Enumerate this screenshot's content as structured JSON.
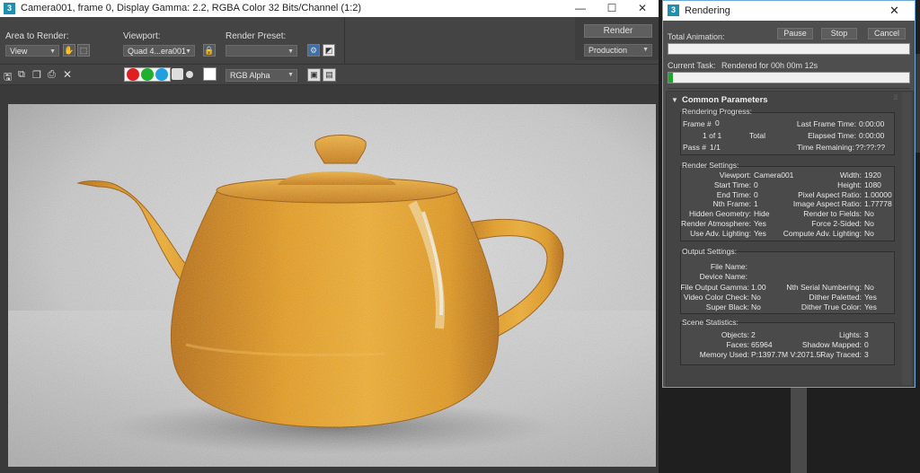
{
  "frame_window": {
    "title": "Camera001, frame 0, Display Gamma: 2.2, RGBA Color 32 Bits/Channel (1:2)",
    "icon_letter": "3",
    "minimize": "—",
    "maximize": "☐",
    "close": "✕",
    "area_to_render_label": "Area to Render:",
    "area_to_render_value": "View",
    "viewport_label": "Viewport:",
    "viewport_value": "Quad 4...era001",
    "render_preset_label": "Render Preset:",
    "render_preset_value": "",
    "render_button": "Render",
    "production_value": "Production",
    "channel_display_value": "RGB Alpha",
    "channel_colors": {
      "red": "#e02020",
      "green": "#20b030",
      "blue": "#20a0e0"
    }
  },
  "rendering_dialog": {
    "icon_letter": "3",
    "title": "Rendering",
    "close": "✕",
    "total_animation_label": "Total Animation:",
    "pause_button": "Pause",
    "stop_button": "Stop",
    "cancel_button": "Cancel",
    "current_task_label": "Current Task:",
    "current_task_value": "Rendered for 00h 00m 12s",
    "current_task_progress": 0.02,
    "common_parameters_label": "Common Parameters",
    "rendering_progress": {
      "label": "Rendering Progress:",
      "frame_label": "Frame #",
      "frame_value": "0",
      "of_value": "1 of 1",
      "total_label": "Total",
      "pass_label": "Pass #",
      "pass_value": "1/1",
      "last_frame_time_label": "Last Frame Time:",
      "last_frame_time_value": "0:00:00",
      "elapsed_time_label": "Elapsed Time:",
      "elapsed_time_value": "0:00:00",
      "time_remaining_label": "Time Remaining:",
      "time_remaining_value": "??:??:??"
    },
    "render_settings": {
      "label": "Render Settings:",
      "left": [
        {
          "label": "Viewport:",
          "value": "Camera001"
        },
        {
          "label": "Start Time:",
          "value": "0"
        },
        {
          "label": "End Time:",
          "value": "0"
        },
        {
          "label": "Nth Frame:",
          "value": "1"
        },
        {
          "label": "Hidden Geometry:",
          "value": "Hide"
        },
        {
          "label": "Render Atmosphere:",
          "value": "Yes"
        },
        {
          "label": "Use Adv. Lighting:",
          "value": "Yes"
        }
      ],
      "right": [
        {
          "label": "Width:",
          "value": "1920"
        },
        {
          "label": "Height:",
          "value": "1080"
        },
        {
          "label": "Pixel Aspect Ratio:",
          "value": "1.00000"
        },
        {
          "label": "Image Aspect Ratio:",
          "value": "1.77778"
        },
        {
          "label": "Render to Fields:",
          "value": "No"
        },
        {
          "label": "Force 2-Sided:",
          "value": "No"
        },
        {
          "label": "Compute Adv. Lighting:",
          "value": "No"
        }
      ]
    },
    "output_settings": {
      "label": "Output Settings:",
      "file_name_label": "File Name:",
      "file_name_value": "",
      "device_name_label": "Device Name:",
      "device_name_value": "",
      "left": [
        {
          "label": "File Output Gamma:",
          "value": "1.00"
        },
        {
          "label": "Video Color Check:",
          "value": "No"
        },
        {
          "label": "Super Black:",
          "value": "No"
        }
      ],
      "right": [
        {
          "label": "Nth Serial Numbering:",
          "value": "No"
        },
        {
          "label": "Dither Paletted:",
          "value": "Yes"
        },
        {
          "label": "Dither True Color:",
          "value": "Yes"
        }
      ]
    },
    "scene_statistics": {
      "label": "Scene Statistics:",
      "left": [
        {
          "label": "Objects:",
          "value": "2"
        },
        {
          "label": "Faces:",
          "value": "65964"
        },
        {
          "label": "Memory Used:",
          "value": "P:1397.7M V:2071.5I"
        }
      ],
      "right": [
        {
          "label": "Lights:",
          "value": "3"
        },
        {
          "label": "Shadow Mapped:",
          "value": "0"
        },
        {
          "label": "Ray Traced:",
          "value": "3"
        }
      ]
    }
  }
}
